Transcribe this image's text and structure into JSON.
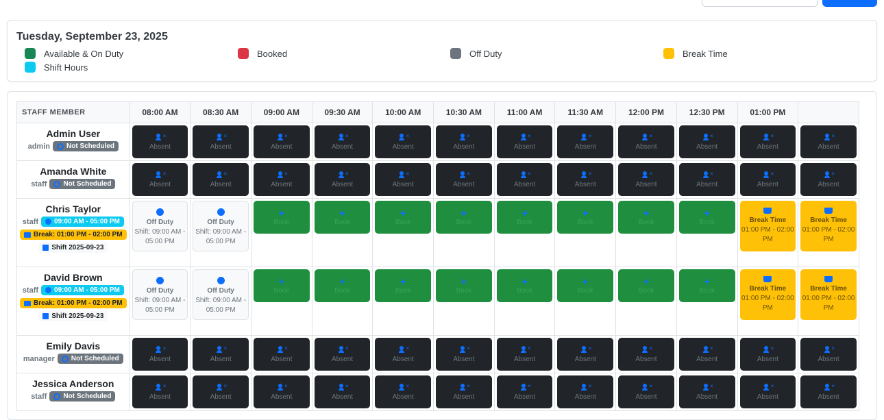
{
  "date_title": "Tuesday, September 23, 2025",
  "legend": [
    {
      "label": "Available & On Duty",
      "color": "#198754"
    },
    {
      "label": "Booked",
      "color": "#dc3545"
    },
    {
      "label": "Off Duty",
      "color": "#6c757d"
    },
    {
      "label": "Break Time",
      "color": "#ffc107"
    },
    {
      "label": "Shift Hours",
      "color": "#0dcaf0"
    }
  ],
  "table": {
    "staff_header": "STAFF MEMBER",
    "times": [
      "08:00 AM",
      "08:30 AM",
      "09:00 AM",
      "09:30 AM",
      "10:00 AM",
      "10:30 AM",
      "11:00 AM",
      "11:30 AM",
      "12:00 PM",
      "12:30 PM",
      "01:00 PM"
    ],
    "labels": {
      "absent": "Absent",
      "book": "Book",
      "off_duty": "Off Duty",
      "off_duty_shift": "Shift: 09:00 AM - 05:00 PM",
      "break_time": "Break Time",
      "break_range": "01:00 PM - 02:00 PM"
    },
    "staff": [
      {
        "name": "Admin User",
        "role": "admin",
        "badge": "Not Scheduled"
      },
      {
        "name": "Amanda White",
        "role": "staff",
        "badge": "Not Scheduled"
      },
      {
        "name": "Chris Taylor",
        "role": "staff",
        "shift": "09:00 AM - 05:00 PM",
        "break": "Break: 01:00 PM - 02:00 PM",
        "date": "Shift 2025-09-23"
      },
      {
        "name": "David Brown",
        "role": "staff",
        "shift": "09:00 AM - 05:00 PM",
        "break": "Break: 01:00 PM - 02:00 PM",
        "date": "Shift 2025-09-23"
      },
      {
        "name": "Emily Davis",
        "role": "manager",
        "badge": "Not Scheduled"
      },
      {
        "name": "Jessica Anderson",
        "role": "staff",
        "badge": "Not Scheduled"
      }
    ]
  }
}
